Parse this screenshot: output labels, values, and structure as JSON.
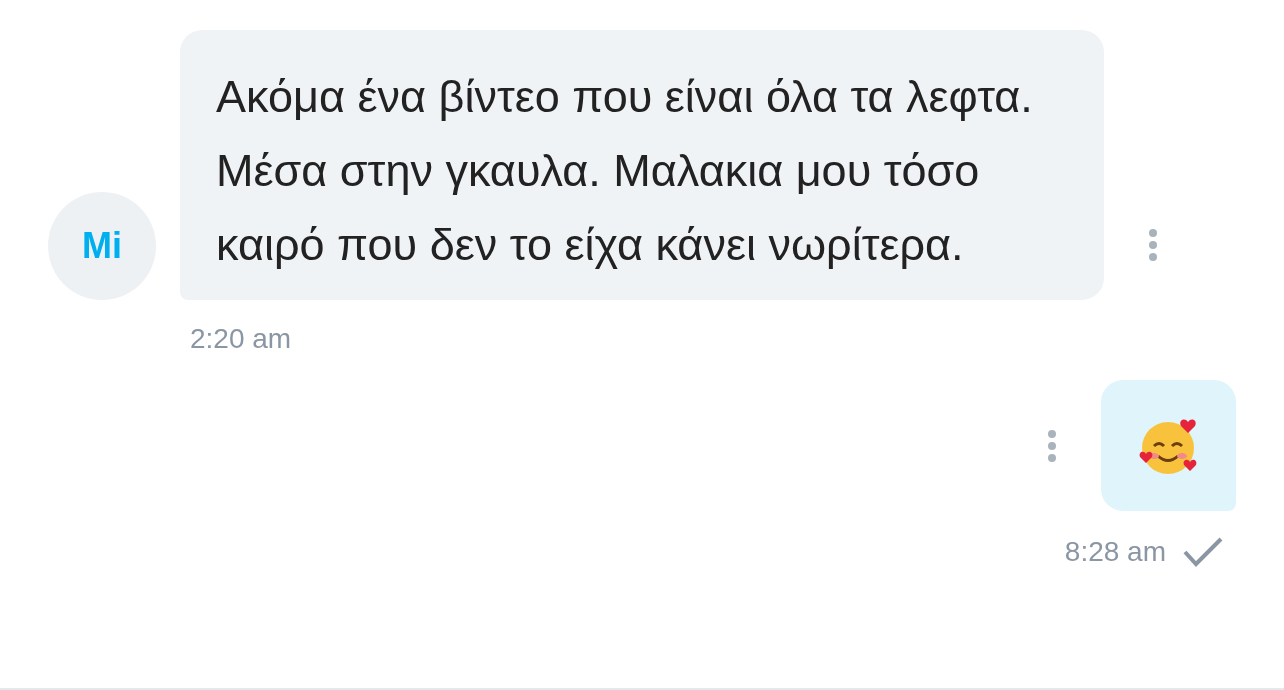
{
  "messages": [
    {
      "kind": "text",
      "outgoing": false,
      "avatar": "Mi",
      "text": "Ακόμα ένα βίντεο που είναι όλα τα λεφτα. Μέσα στην γκαυλα. Μαλακια μου τόσο καιρό που δεν το είχα κάνει νωρίτερα.",
      "time": "2:20 am",
      "read": false
    },
    {
      "kind": "emoji",
      "outgoing": true,
      "time": "8:28 am",
      "read": true
    }
  ]
}
